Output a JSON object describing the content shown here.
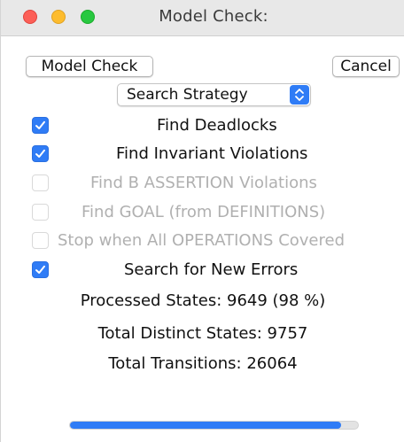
{
  "window": {
    "title": "Model Check:"
  },
  "buttons": {
    "model_check": "Model Check",
    "cancel": "Cancel"
  },
  "strategy": {
    "selected": "Search Strategy"
  },
  "options": [
    {
      "label": "Find Deadlocks",
      "checked": true,
      "enabled": true
    },
    {
      "label": "Find Invariant Violations",
      "checked": true,
      "enabled": true
    },
    {
      "label": "Find B ASSERTION Violations",
      "checked": false,
      "enabled": false
    },
    {
      "label": "Find GOAL (from DEFINITIONS)",
      "checked": false,
      "enabled": false
    },
    {
      "label": "Stop when All OPERATIONS Covered",
      "checked": false,
      "enabled": false
    },
    {
      "label": "Search for New Errors",
      "checked": true,
      "enabled": true
    }
  ],
  "stats": {
    "processed_states": "Processed States:  9649 (98 %)",
    "total_distinct_states": "Total Distinct States:  9757",
    "total_transitions": "Total Transitions:  26064"
  },
  "progress": {
    "fraction": 0.94
  },
  "colors": {
    "accent": "#2f7cf6",
    "close": "#fc5f57",
    "minimize": "#fdbc2e",
    "zoom": "#28c840",
    "disabled_text": "#b0b0b0"
  },
  "icons": {
    "close": "close-icon",
    "minimize": "minimize-icon",
    "zoom": "zoom-icon",
    "checkmark": "checkmark-icon",
    "updown": "chevron-updown-icon"
  }
}
